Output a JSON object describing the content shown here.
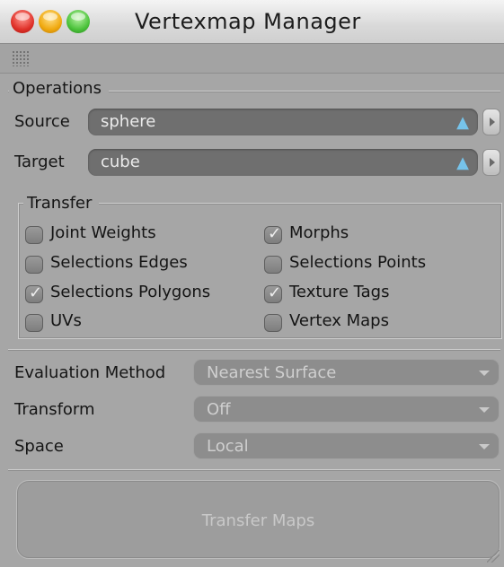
{
  "window": {
    "title": "Vertexmap Manager"
  },
  "operations": {
    "group_label": "Operations",
    "source_label": "Source",
    "source_value": "sphere",
    "target_label": "Target",
    "target_value": "cube"
  },
  "transfer": {
    "group_label": "Transfer",
    "options": [
      {
        "label": "Joint Weights",
        "checked": false
      },
      {
        "label": "Morphs",
        "checked": true
      },
      {
        "label": "Selections Edges",
        "checked": false
      },
      {
        "label": "Selections Points",
        "checked": false
      },
      {
        "label": "Selections Polygons",
        "checked": true
      },
      {
        "label": "Texture Tags",
        "checked": true
      },
      {
        "label": "UVs",
        "checked": false
      },
      {
        "label": "Vertex Maps",
        "checked": false
      }
    ]
  },
  "settings": {
    "evaluation_label": "Evaluation Method",
    "evaluation_value": "Nearest Surface",
    "transform_label": "Transform",
    "transform_value": "Off",
    "space_label": "Space",
    "space_value": "Local"
  },
  "actions": {
    "transfer_maps": "Transfer Maps"
  },
  "icons": {
    "source_link": "link-icon",
    "target_link": "link-icon",
    "grip": "grip-icon"
  },
  "colors": {
    "window_bg": "#a6a6a6",
    "field_bg": "#6f6f6f",
    "link_icon": "#76c3ea"
  }
}
